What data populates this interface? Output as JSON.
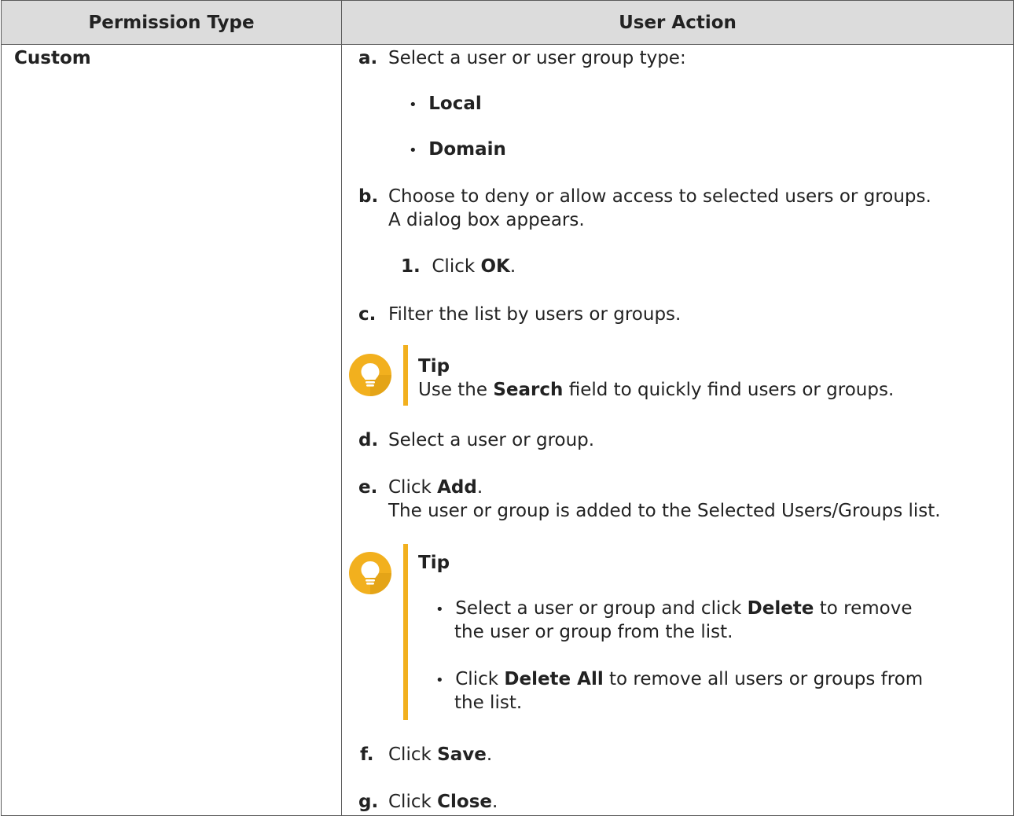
{
  "table": {
    "header": {
      "col1": "Permission Type",
      "col2": "User Action"
    },
    "type_label": "Custom"
  },
  "steps": {
    "a": {
      "letter": "a.",
      "text": "Select a user or user group type:",
      "bullets": [
        "Local",
        "Domain"
      ]
    },
    "b": {
      "letter": "b.",
      "text": "Choose to deny or allow access to selected users or groups.",
      "line2": "A dialog box appears.",
      "sub_num": "1.",
      "sub_pre": "Click ",
      "sub_bold": "OK",
      "sub_post": "."
    },
    "c": {
      "letter": "c.",
      "text": "Filter the list by users or groups."
    },
    "tip1": {
      "title": "Tip",
      "pre": "Use the ",
      "bold": "Search",
      "post": " field to quickly find users or groups."
    },
    "d": {
      "letter": "d.",
      "text": "Select a user or group."
    },
    "e": {
      "letter": "e.",
      "pre": "Click ",
      "bold": "Add",
      "post": ".",
      "line2": "The user or group is added to the Selected Users/Groups list."
    },
    "tip2": {
      "title": "Tip",
      "bullet1_pre": "Select a user or group and click ",
      "bullet1_bold": "Delete",
      "bullet1_post": " to remove",
      "bullet1_line2": "the user or group from the list.",
      "bullet2_pre": "Click ",
      "bullet2_bold": "Delete All",
      "bullet2_post": " to remove all users or groups from",
      "bullet2_line2": "the list."
    },
    "f": {
      "letter": "f.",
      "pre": "Click ",
      "bold": "Save",
      "post": "."
    },
    "g": {
      "letter": "g.",
      "pre": "Click ",
      "bold": "Close",
      "post": "."
    }
  },
  "icons": {
    "tip": "lightbulb-icon"
  },
  "colors": {
    "header_bg": "#dcdcdc",
    "tip_accent": "#f2b01e",
    "border": "#5a5a5a"
  }
}
